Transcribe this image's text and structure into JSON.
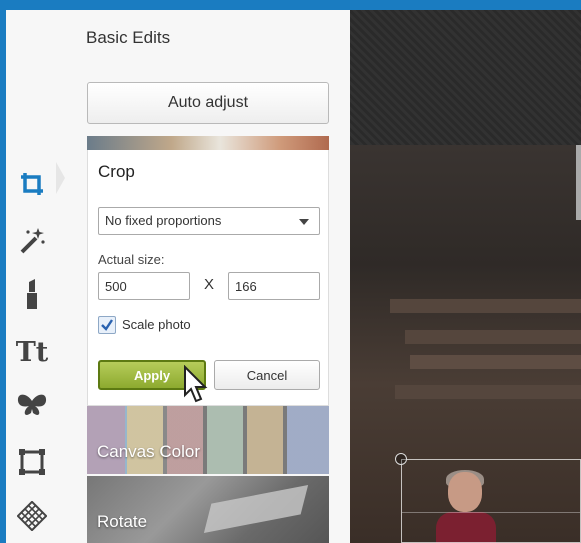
{
  "panel": {
    "title": "Basic Edits",
    "auto_adjust_label": "Auto adjust"
  },
  "rail": {
    "icons": [
      "crop-icon",
      "magic-wand-icon",
      "lipstick-icon",
      "text-icon",
      "butterfly-icon",
      "frame-icon",
      "texture-icon"
    ],
    "text_icon_glyph": "Tt",
    "accent": "#1a7cc1"
  },
  "crop": {
    "title": "Crop",
    "proportions_selected": "No fixed proportions",
    "actual_size_label": "Actual size:",
    "width": "500",
    "height": "166",
    "separator": "X",
    "scale_photo_label": "Scale photo",
    "scale_photo_checked": true,
    "apply_label": "Apply",
    "cancel_label": "Cancel"
  },
  "tiles": {
    "canvas_color": "Canvas Color",
    "rotate": "Rotate"
  }
}
